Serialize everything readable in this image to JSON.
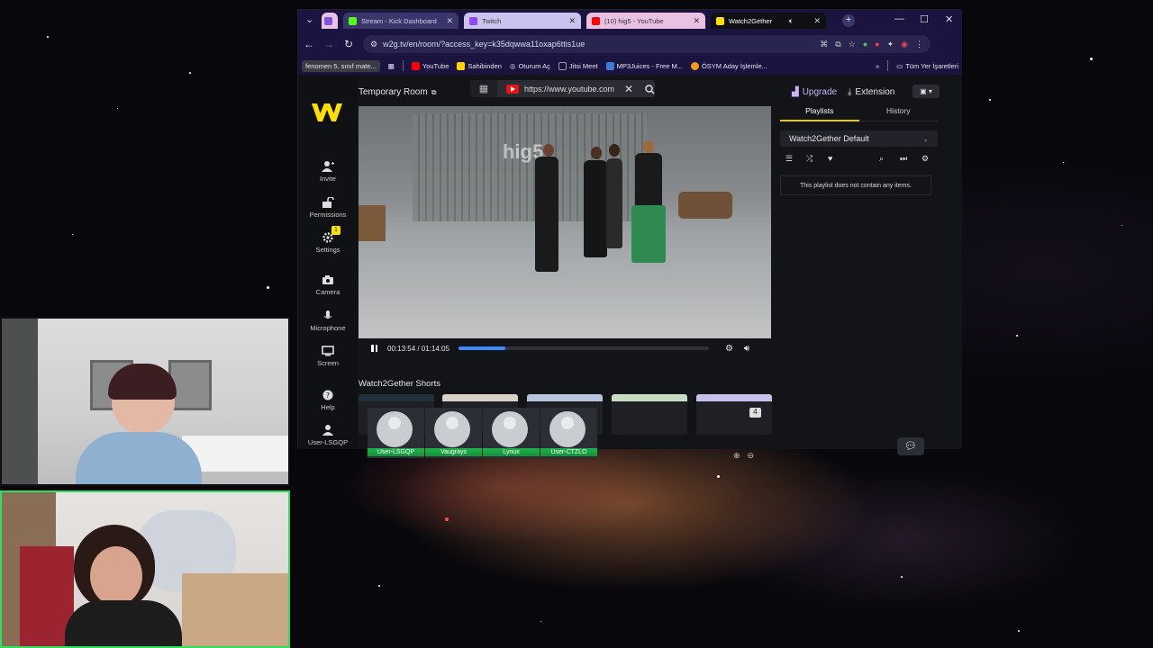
{
  "browser": {
    "tabs": [
      {
        "label": "Stream - Kick Dashboard",
        "color": "#53fc18"
      },
      {
        "label": "Twitch",
        "color": "#9146ff"
      },
      {
        "label": "(10) hig5 - YouTube",
        "color": "#ff0000"
      },
      {
        "label": "Watch2Gether",
        "color": "#ffe000"
      }
    ],
    "url": "w2g.tv/en/room/?access_key=k35dqwwa11oxap6ttis1ue",
    "bookmarks": {
      "first": "fenomen 5. sınıf mate...",
      "items": [
        "YouTube",
        "Sahibinden",
        "Oturum Aç",
        "Jitsi Meet",
        "MP3Juices - Free M...",
        "ÖSYM Aday İşlemle..."
      ],
      "all": "Tüm Yer İşaretleri",
      "more": "»"
    }
  },
  "app": {
    "room_title": "Temporary Room",
    "media_url": "https://www.youtube.com",
    "upgrade": "Upgrade",
    "extension": "Extension",
    "nav": {
      "invite": "Invite",
      "permissions": "Permissions",
      "settings": "Settings",
      "settings_badge": "1",
      "camera": "Camera",
      "microphone": "Microphone",
      "screen": "Screen",
      "help": "Help",
      "user": "User-LSGQP"
    },
    "player": {
      "watermark": "hig5",
      "time": "00:13:54 / 01:14:05",
      "progress": 0.188
    },
    "shorts_title": "Watch2Gether Shorts",
    "users": [
      "User-LSGQP",
      "Vaugrays",
      "Lynux",
      "User-CTZLO"
    ],
    "user_count_badge": "4",
    "right": {
      "tabs": [
        "Playlists",
        "History"
      ],
      "playlist_name": "Watch2Gether Default",
      "empty_msg": "This playlist does not contain any items."
    }
  },
  "colors": {
    "accent": "#ffe000",
    "progress": "#3d8bfd",
    "upgrade": "#c7b3ff",
    "user_tag": "#20b34a",
    "cam_border": "#2fe05e"
  }
}
